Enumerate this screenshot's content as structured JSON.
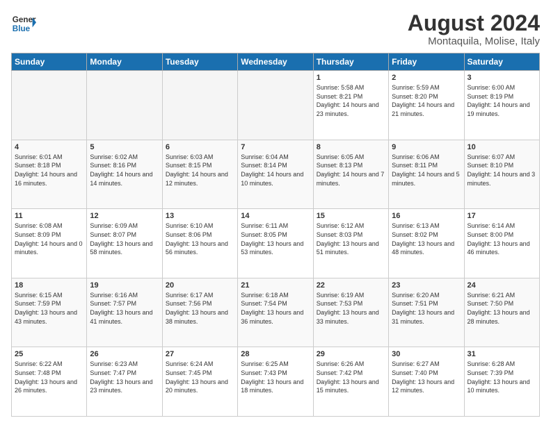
{
  "header": {
    "logo_line1": "General",
    "logo_line2": "Blue",
    "month_year": "August 2024",
    "location": "Montaquila, Molise, Italy"
  },
  "days_of_week": [
    "Sunday",
    "Monday",
    "Tuesday",
    "Wednesday",
    "Thursday",
    "Friday",
    "Saturday"
  ],
  "weeks": [
    [
      {
        "day": "",
        "info": ""
      },
      {
        "day": "",
        "info": ""
      },
      {
        "day": "",
        "info": ""
      },
      {
        "day": "",
        "info": ""
      },
      {
        "day": "1",
        "info": "Sunrise: 5:58 AM\nSunset: 8:21 PM\nDaylight: 14 hours and 23 minutes."
      },
      {
        "day": "2",
        "info": "Sunrise: 5:59 AM\nSunset: 8:20 PM\nDaylight: 14 hours and 21 minutes."
      },
      {
        "day": "3",
        "info": "Sunrise: 6:00 AM\nSunset: 8:19 PM\nDaylight: 14 hours and 19 minutes."
      }
    ],
    [
      {
        "day": "4",
        "info": "Sunrise: 6:01 AM\nSunset: 8:18 PM\nDaylight: 14 hours and 16 minutes."
      },
      {
        "day": "5",
        "info": "Sunrise: 6:02 AM\nSunset: 8:16 PM\nDaylight: 14 hours and 14 minutes."
      },
      {
        "day": "6",
        "info": "Sunrise: 6:03 AM\nSunset: 8:15 PM\nDaylight: 14 hours and 12 minutes."
      },
      {
        "day": "7",
        "info": "Sunrise: 6:04 AM\nSunset: 8:14 PM\nDaylight: 14 hours and 10 minutes."
      },
      {
        "day": "8",
        "info": "Sunrise: 6:05 AM\nSunset: 8:13 PM\nDaylight: 14 hours and 7 minutes."
      },
      {
        "day": "9",
        "info": "Sunrise: 6:06 AM\nSunset: 8:11 PM\nDaylight: 14 hours and 5 minutes."
      },
      {
        "day": "10",
        "info": "Sunrise: 6:07 AM\nSunset: 8:10 PM\nDaylight: 14 hours and 3 minutes."
      }
    ],
    [
      {
        "day": "11",
        "info": "Sunrise: 6:08 AM\nSunset: 8:09 PM\nDaylight: 14 hours and 0 minutes."
      },
      {
        "day": "12",
        "info": "Sunrise: 6:09 AM\nSunset: 8:07 PM\nDaylight: 13 hours and 58 minutes."
      },
      {
        "day": "13",
        "info": "Sunrise: 6:10 AM\nSunset: 8:06 PM\nDaylight: 13 hours and 56 minutes."
      },
      {
        "day": "14",
        "info": "Sunrise: 6:11 AM\nSunset: 8:05 PM\nDaylight: 13 hours and 53 minutes."
      },
      {
        "day": "15",
        "info": "Sunrise: 6:12 AM\nSunset: 8:03 PM\nDaylight: 13 hours and 51 minutes."
      },
      {
        "day": "16",
        "info": "Sunrise: 6:13 AM\nSunset: 8:02 PM\nDaylight: 13 hours and 48 minutes."
      },
      {
        "day": "17",
        "info": "Sunrise: 6:14 AM\nSunset: 8:00 PM\nDaylight: 13 hours and 46 minutes."
      }
    ],
    [
      {
        "day": "18",
        "info": "Sunrise: 6:15 AM\nSunset: 7:59 PM\nDaylight: 13 hours and 43 minutes."
      },
      {
        "day": "19",
        "info": "Sunrise: 6:16 AM\nSunset: 7:57 PM\nDaylight: 13 hours and 41 minutes."
      },
      {
        "day": "20",
        "info": "Sunrise: 6:17 AM\nSunset: 7:56 PM\nDaylight: 13 hours and 38 minutes."
      },
      {
        "day": "21",
        "info": "Sunrise: 6:18 AM\nSunset: 7:54 PM\nDaylight: 13 hours and 36 minutes."
      },
      {
        "day": "22",
        "info": "Sunrise: 6:19 AM\nSunset: 7:53 PM\nDaylight: 13 hours and 33 minutes."
      },
      {
        "day": "23",
        "info": "Sunrise: 6:20 AM\nSunset: 7:51 PM\nDaylight: 13 hours and 31 minutes."
      },
      {
        "day": "24",
        "info": "Sunrise: 6:21 AM\nSunset: 7:50 PM\nDaylight: 13 hours and 28 minutes."
      }
    ],
    [
      {
        "day": "25",
        "info": "Sunrise: 6:22 AM\nSunset: 7:48 PM\nDaylight: 13 hours and 26 minutes."
      },
      {
        "day": "26",
        "info": "Sunrise: 6:23 AM\nSunset: 7:47 PM\nDaylight: 13 hours and 23 minutes."
      },
      {
        "day": "27",
        "info": "Sunrise: 6:24 AM\nSunset: 7:45 PM\nDaylight: 13 hours and 20 minutes."
      },
      {
        "day": "28",
        "info": "Sunrise: 6:25 AM\nSunset: 7:43 PM\nDaylight: 13 hours and 18 minutes."
      },
      {
        "day": "29",
        "info": "Sunrise: 6:26 AM\nSunset: 7:42 PM\nDaylight: 13 hours and 15 minutes."
      },
      {
        "day": "30",
        "info": "Sunrise: 6:27 AM\nSunset: 7:40 PM\nDaylight: 13 hours and 12 minutes."
      },
      {
        "day": "31",
        "info": "Sunrise: 6:28 AM\nSunset: 7:39 PM\nDaylight: 13 hours and 10 minutes."
      }
    ]
  ]
}
